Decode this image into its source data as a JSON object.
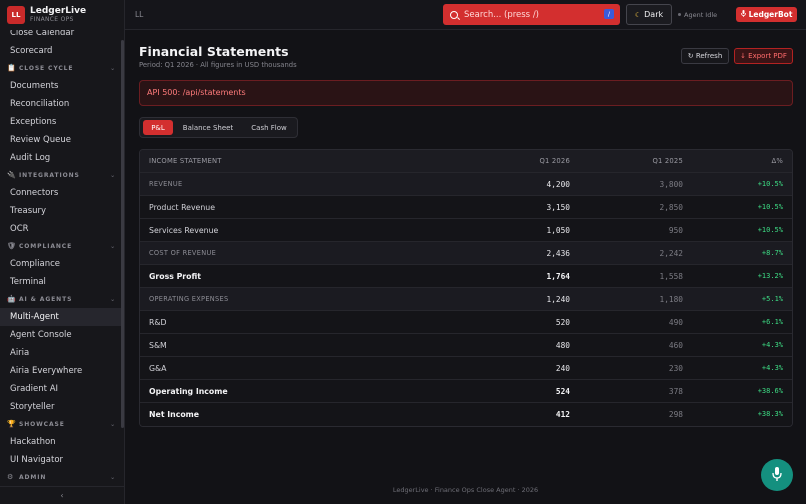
{
  "brand": {
    "logo": "LL",
    "name": "LedgerLive",
    "subtitle": "FINANCE OPS"
  },
  "sidebar": {
    "items": [
      {
        "type": "item",
        "label": "Close Calendar"
      },
      {
        "type": "item",
        "label": "Scorecard"
      },
      {
        "type": "section",
        "label": "CLOSE CYCLE",
        "icon": "clipboard-icon"
      },
      {
        "type": "item",
        "label": "Documents"
      },
      {
        "type": "item",
        "label": "Reconciliation"
      },
      {
        "type": "item",
        "label": "Exceptions"
      },
      {
        "type": "item",
        "label": "Review Queue"
      },
      {
        "type": "item",
        "label": "Audit Log"
      },
      {
        "type": "section",
        "label": "INTEGRATIONS",
        "icon": "plug-icon"
      },
      {
        "type": "item",
        "label": "Connectors"
      },
      {
        "type": "item",
        "label": "Treasury"
      },
      {
        "type": "item",
        "label": "OCR"
      },
      {
        "type": "section",
        "label": "COMPLIANCE",
        "icon": "shield-icon"
      },
      {
        "type": "item",
        "label": "Compliance"
      },
      {
        "type": "item",
        "label": "Terminal"
      },
      {
        "type": "section",
        "label": "AI & AGENTS",
        "icon": "robot-icon"
      },
      {
        "type": "item",
        "label": "Multi-Agent",
        "active": true
      },
      {
        "type": "item",
        "label": "Agent Console"
      },
      {
        "type": "item",
        "label": "Airia"
      },
      {
        "type": "item",
        "label": "Airia Everywhere"
      },
      {
        "type": "item",
        "label": "Gradient AI"
      },
      {
        "type": "item",
        "label": "Storyteller"
      },
      {
        "type": "section",
        "label": "SHOWCASE",
        "icon": "trophy-icon"
      },
      {
        "type": "item",
        "label": "Hackathon"
      },
      {
        "type": "item",
        "label": "UI Navigator"
      },
      {
        "type": "section",
        "label": "ADMIN",
        "icon": "gear-icon"
      }
    ],
    "collapse_icon": "chevron-left-icon"
  },
  "topbar": {
    "breadcrumb": "LL",
    "search_placeholder": "Search... (press /)",
    "search_kbd": "/",
    "theme_label": "Dark",
    "agent_status": "Agent Idle",
    "bot_label": "LedgerBot"
  },
  "page": {
    "title": "Financial Statements",
    "subtitle": "Period: Q1 2026 · All figures in USD thousands",
    "refresh_label": "↻ Refresh",
    "export_label": "↓ Export PDF",
    "error": "API 500: /api/statements"
  },
  "tabs": [
    {
      "label": "P&L",
      "active": true
    },
    {
      "label": "Balance Sheet",
      "active": false
    },
    {
      "label": "Cash Flow",
      "active": false
    }
  ],
  "table": {
    "headers": {
      "label": "INCOME STATEMENT",
      "q1": "Q1 2026",
      "py": "Q1 2025",
      "delta": "Δ%"
    },
    "rows": [
      {
        "kind": "section",
        "label": "REVENUE",
        "q1": "4,200",
        "py": "3,800",
        "delta": "+10.5%"
      },
      {
        "kind": "item",
        "label": "Product Revenue",
        "q1": "3,150",
        "py": "2,850",
        "delta": "+10.5%"
      },
      {
        "kind": "item",
        "label": "Services Revenue",
        "q1": "1,050",
        "py": "950",
        "delta": "+10.5%"
      },
      {
        "kind": "section",
        "label": "COST OF REVENUE",
        "q1": "2,436",
        "py": "2,242",
        "delta": "+8.7%"
      },
      {
        "kind": "bold",
        "label": "Gross Profit",
        "q1": "1,764",
        "py": "1,558",
        "delta": "+13.2%"
      },
      {
        "kind": "section",
        "label": "OPERATING EXPENSES",
        "q1": "1,240",
        "py": "1,180",
        "delta": "+5.1%"
      },
      {
        "kind": "item",
        "label": "R&D",
        "q1": "520",
        "py": "490",
        "delta": "+6.1%"
      },
      {
        "kind": "item",
        "label": "S&M",
        "q1": "480",
        "py": "460",
        "delta": "+4.3%"
      },
      {
        "kind": "item",
        "label": "G&A",
        "q1": "240",
        "py": "230",
        "delta": "+4.3%"
      },
      {
        "kind": "bold",
        "label": "Operating Income",
        "q1": "524",
        "py": "378",
        "delta": "+38.6%"
      },
      {
        "kind": "bold",
        "label": "Net Income",
        "q1": "412",
        "py": "298",
        "delta": "+38.3%"
      }
    ]
  },
  "footer": "LedgerLive · Finance Ops Close Agent · 2026",
  "fab_icon": "microphone-icon",
  "colors": {
    "accent": "#d32f2f",
    "positive": "#3ddc84",
    "fab": "#14907f"
  }
}
